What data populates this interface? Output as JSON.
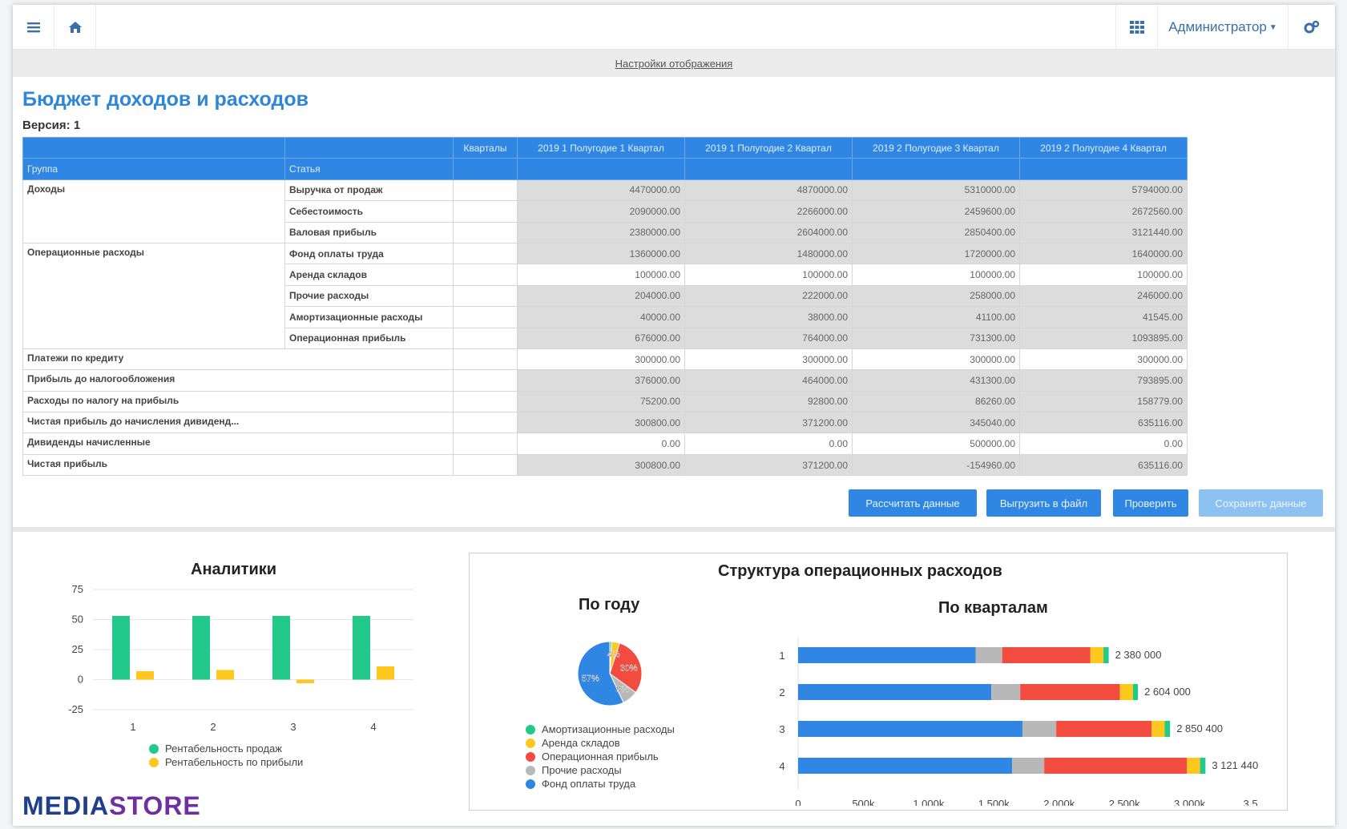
{
  "topbar": {
    "menu_icon": "hamburger-icon",
    "home_icon": "home-icon",
    "apps_icon": "grid-icon",
    "user_label": "Администратор",
    "settings_icon": "gears-icon"
  },
  "display_settings_link": "Настройки отображения",
  "page_title": "Бюджет доходов и расходов",
  "version_label": "Версия: 1",
  "table": {
    "header_row1": [
      "",
      "",
      "Кварталы",
      "2019 1 Полугодие 1 Квартал",
      "2019 1 Полугодие 2 Квартал",
      "2019 2 Полугодие 3 Квартал",
      "2019 2 Полугодие 4 Квартал"
    ],
    "header_row2": [
      "Группа",
      "Статья"
    ],
    "rows": [
      {
        "group": "Доходы",
        "article": "Выручка от продаж",
        "values": [
          "4470000.00",
          "4870000.00",
          "5310000.00",
          "5794000.00"
        ]
      },
      {
        "group": "",
        "article": "Себестоимость",
        "values": [
          "2090000.00",
          "2266000.00",
          "2459600.00",
          "2672560.00"
        ]
      },
      {
        "group": "",
        "article": "Валовая прибыль",
        "values": [
          "2380000.00",
          "2604000.00",
          "2850400.00",
          "3121440.00"
        ]
      },
      {
        "group": "Операционные расходы",
        "article": "Фонд оплаты труда",
        "values": [
          "1360000.00",
          "1480000.00",
          "1720000.00",
          "1640000.00"
        ]
      },
      {
        "group": "",
        "article": "Аренда складов",
        "values": [
          "100000.00",
          "100000.00",
          "100000.00",
          "100000.00"
        ]
      },
      {
        "group": "",
        "article": "Прочие расходы",
        "values": [
          "204000.00",
          "222000.00",
          "258000.00",
          "246000.00"
        ]
      },
      {
        "group": "",
        "article": "Амортизационные расходы",
        "values": [
          "40000.00",
          "38000.00",
          "41100.00",
          "41545.00"
        ]
      },
      {
        "group": "",
        "article": "Операционная прибыль",
        "values": [
          "676000.00",
          "764000.00",
          "731300.00",
          "1093895.00"
        ]
      },
      {
        "group": "Платежи по кредиту",
        "article": "",
        "values": [
          "300000.00",
          "300000.00",
          "300000.00",
          "300000.00"
        ]
      },
      {
        "group": "Прибыль до налогообложения",
        "article": "",
        "values": [
          "376000.00",
          "464000.00",
          "431300.00",
          "793895.00"
        ]
      },
      {
        "group": "Расходы по налогу на прибыль",
        "article": "",
        "values": [
          "75200.00",
          "92800.00",
          "86260.00",
          "158779.00"
        ]
      },
      {
        "group": "Чистая прибыль до начисления дивиденд...",
        "article": "",
        "values": [
          "300800.00",
          "371200.00",
          "345040.00",
          "635116.00"
        ]
      },
      {
        "group": "Дивиденды начисленные",
        "article": "",
        "values": [
          "0.00",
          "0.00",
          "500000.00",
          "0.00"
        ]
      },
      {
        "group": "Чистая прибыль",
        "article": "",
        "values": [
          "300800.00",
          "371200.00",
          "-154960.00",
          "635116.00"
        ]
      }
    ]
  },
  "buttons": {
    "calculate": "Рассчитать данные",
    "export": "Выгрузить в файл",
    "check": "Проверить",
    "save": "Сохранить данные"
  },
  "analytics": {
    "title": "Аналитики",
    "legend": [
      "Рентабельность продаж",
      "Рентабельность по прибыли"
    ]
  },
  "structure": {
    "title": "Структура операционных расходов",
    "by_year_title": "По году",
    "by_quarter_title": "По кварталам",
    "legend": [
      "Амортизационные расходы",
      "Аренда складов",
      "Операционная прибыль",
      "Прочие расходы",
      "Фонд оплаты труда"
    ]
  },
  "colors": {
    "accent": "#2f86e3",
    "green": "#22c98a",
    "yellow": "#ffc81e",
    "red": "#f24b3f",
    "gray": "#b8b8b8",
    "blue": "#2f86e3"
  },
  "logo": {
    "part1": "MEDIA",
    "part2": "STORE"
  },
  "chart_data": [
    {
      "type": "bar",
      "categories": [
        "1",
        "2",
        "3",
        "4"
      ],
      "series": [
        {
          "name": "Рентабельность продаж",
          "values": [
            53,
            53,
            53,
            53
          ]
        },
        {
          "name": "Рентабельность по прибыли",
          "values": [
            7,
            8,
            -3,
            11
          ]
        }
      ],
      "yticks": [
        75,
        50,
        25,
        0,
        -25
      ],
      "ylim": [
        -25,
        75
      ],
      "title": "Аналитики",
      "legend_position": "bottom"
    },
    {
      "type": "pie",
      "title": "По году",
      "slices": [
        {
          "name": "Амортизационные расходы",
          "value": 1
        },
        {
          "name": "Аренда складов",
          "value": 4
        },
        {
          "name": "Операционная прибыль",
          "value": 30
        },
        {
          "name": "Прочие расходы",
          "value": 8
        },
        {
          "name": "Фонд оплаты труда",
          "value": 57
        }
      ],
      "labels": [
        "4%",
        "30%",
        "8%",
        "57%"
      ]
    },
    {
      "type": "bar",
      "orientation": "horizontal",
      "stacked": true,
      "title": "По кварталам",
      "categories": [
        "1",
        "2",
        "3",
        "4"
      ],
      "series": [
        {
          "name": "Фонд оплаты труда",
          "values": [
            1360000,
            1480000,
            1720000,
            1640000
          ]
        },
        {
          "name": "Прочие расходы",
          "values": [
            204000,
            222000,
            258000,
            246000
          ]
        },
        {
          "name": "Операционная прибыль",
          "values": [
            676000,
            764000,
            731300,
            1093895
          ]
        },
        {
          "name": "Аренда складов",
          "values": [
            100000,
            100000,
            100000,
            100000
          ]
        },
        {
          "name": "Амортизационные расходы",
          "values": [
            40000,
            38000,
            41100,
            41545
          ]
        }
      ],
      "totals": [
        "2 380 000",
        "2 604 000",
        "2 850 400",
        "3 121 440"
      ],
      "xticks": [
        "0",
        "500k",
        "1 000k",
        "1 500k",
        "2 000k",
        "2 500k",
        "3 000k",
        "3 5..."
      ],
      "xlim": [
        0,
        3500000
      ]
    }
  ]
}
